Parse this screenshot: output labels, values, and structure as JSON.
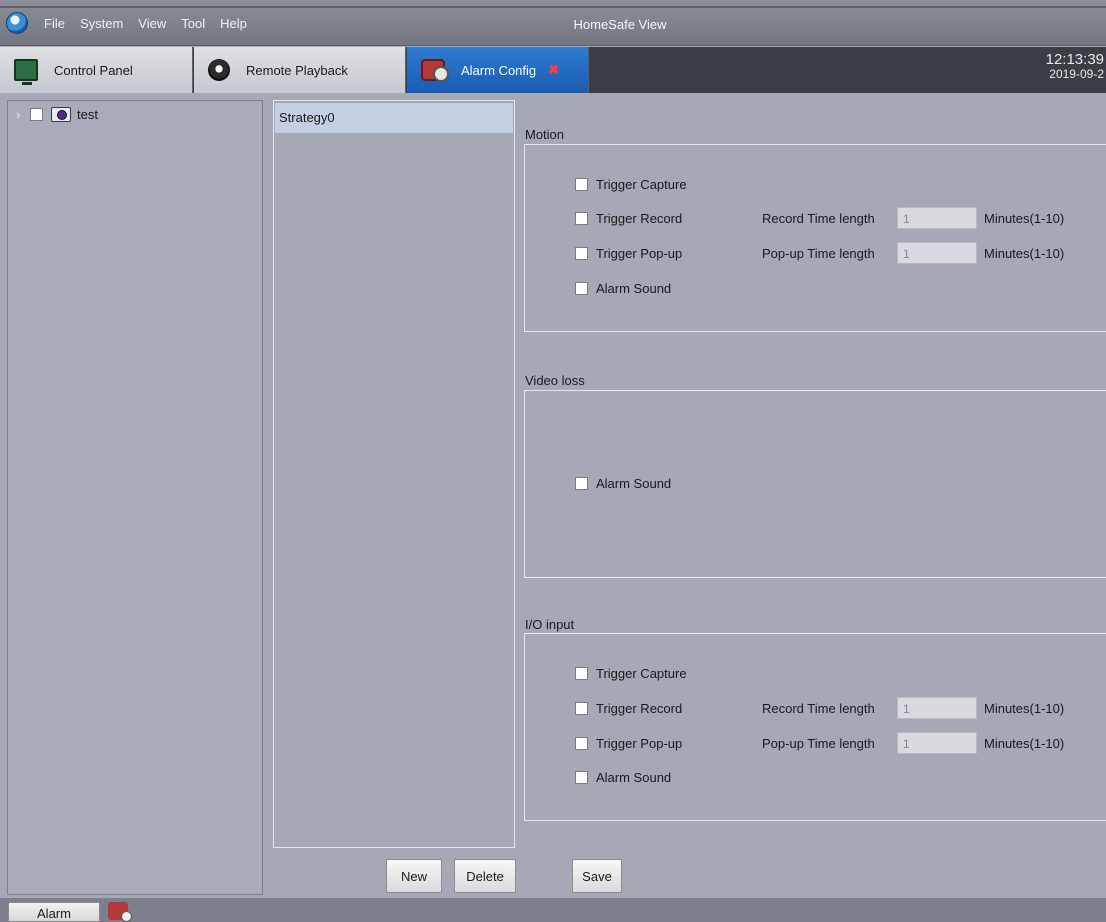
{
  "window": {
    "title": "HomeSafe View"
  },
  "menu": [
    "File",
    "System",
    "View",
    "Tool",
    "Help"
  ],
  "tabs": [
    {
      "label": "Control Panel",
      "icon": "monitor-icon"
    },
    {
      "label": "Remote Playback",
      "icon": "playback-icon"
    },
    {
      "label": "Alarm Config",
      "icon": "alarm-config-icon",
      "active": true
    }
  ],
  "clock": {
    "time": "12:13:39",
    "date": "2019-09-2"
  },
  "device_tree": {
    "items": [
      {
        "label": "test",
        "icon": "camera-icon"
      }
    ]
  },
  "strategies": {
    "items": [
      "Strategy0"
    ],
    "new_label": "New",
    "delete_label": "Delete"
  },
  "sections": {
    "motion": {
      "title": "Motion",
      "trigger_capture": "Trigger Capture",
      "trigger_record": "Trigger Record",
      "record_len_label": "Record Time length",
      "record_len_value": "1",
      "record_unit": "Minutes(1-10)",
      "trigger_popup": "Trigger Pop-up",
      "popup_len_label": "Pop-up Time length",
      "popup_len_value": "1",
      "popup_unit": "Minutes(1-10)",
      "alarm_sound": "Alarm Sound"
    },
    "video_loss": {
      "title": "Video loss",
      "alarm_sound": "Alarm Sound"
    },
    "io_input": {
      "title": "I/O input",
      "trigger_capture": "Trigger Capture",
      "trigger_record": "Trigger Record",
      "record_len_label": "Record Time length",
      "record_len_value": "1",
      "record_unit": "Minutes(1-10)",
      "trigger_popup": "Trigger Pop-up",
      "popup_len_label": "Pop-up Time length",
      "popup_len_value": "1",
      "popup_unit": "Minutes(1-10)",
      "alarm_sound": "Alarm Sound"
    }
  },
  "save_label": "Save",
  "statusbar": {
    "tab_label": "Alarm",
    "icon": "alarm-status-icon"
  },
  "colors": {
    "background": "#a6a8b5",
    "active_tab": "#1f65bd",
    "selected_item": "#c4cfe4"
  }
}
